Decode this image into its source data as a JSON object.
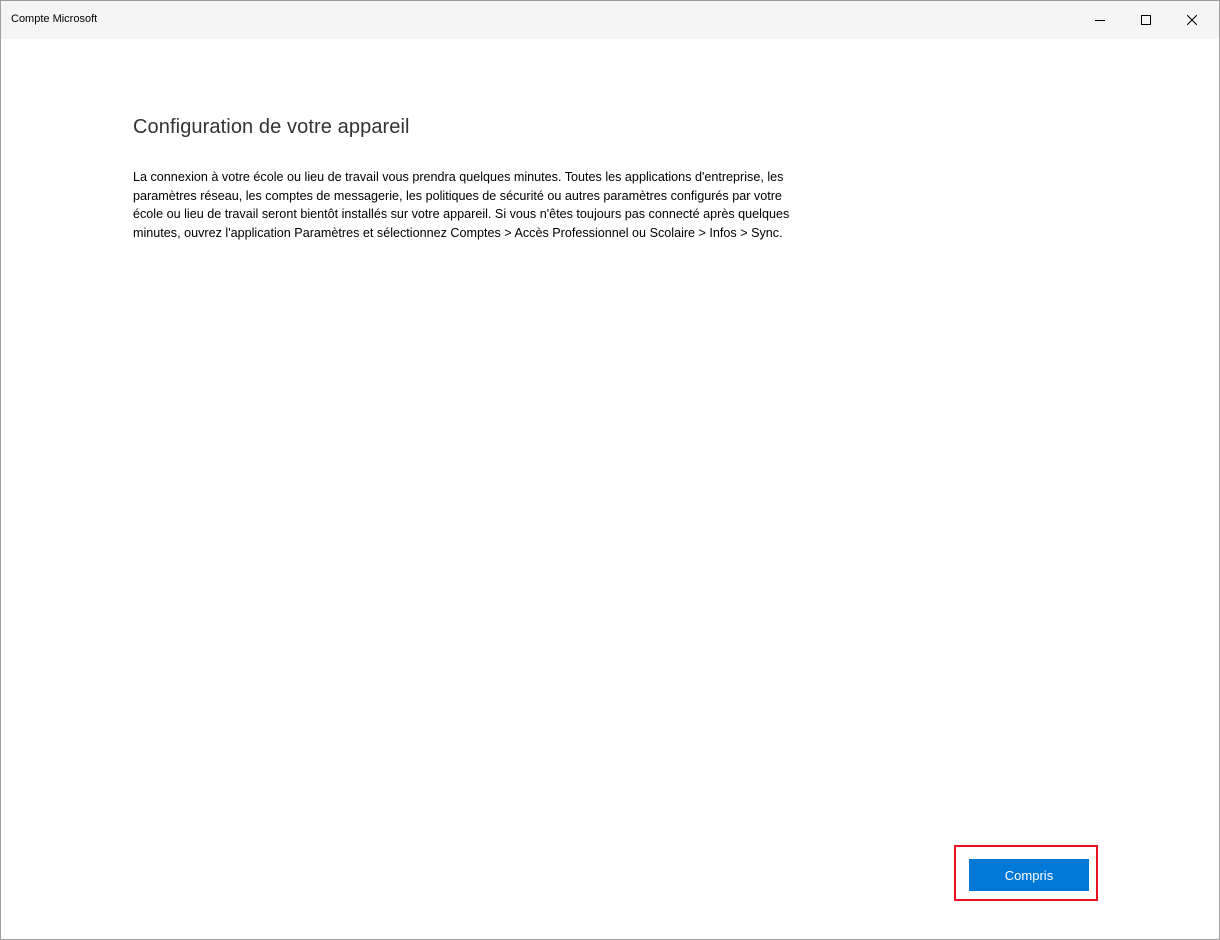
{
  "window": {
    "title": "Compte Microsoft",
    "controls": {
      "minimize_icon": "minimize-icon",
      "maximize_icon": "maximize-icon",
      "close_icon": "close-icon"
    }
  },
  "main": {
    "title": "Configuration de votre appareil",
    "description": "La connexion à votre école ou lieu de travail vous prendra quelques minutes. Toutes les applications d'entreprise, les paramètres réseau, les comptes de messagerie, les politiques de sécurité ou autres paramètres configurés par votre école ou lieu de travail seront bientôt installés sur votre appareil. Si vous n'êtes toujours pas connecté après quelques minutes, ouvrez l'application Paramètres et sélectionnez Comptes > Accès Professionnel ou Scolaire > Infos > Sync.",
    "confirm_button": "Compris"
  },
  "colors": {
    "accent": "#0078d7",
    "highlight": "#e81123",
    "titlebar": "#f5f5f5"
  }
}
